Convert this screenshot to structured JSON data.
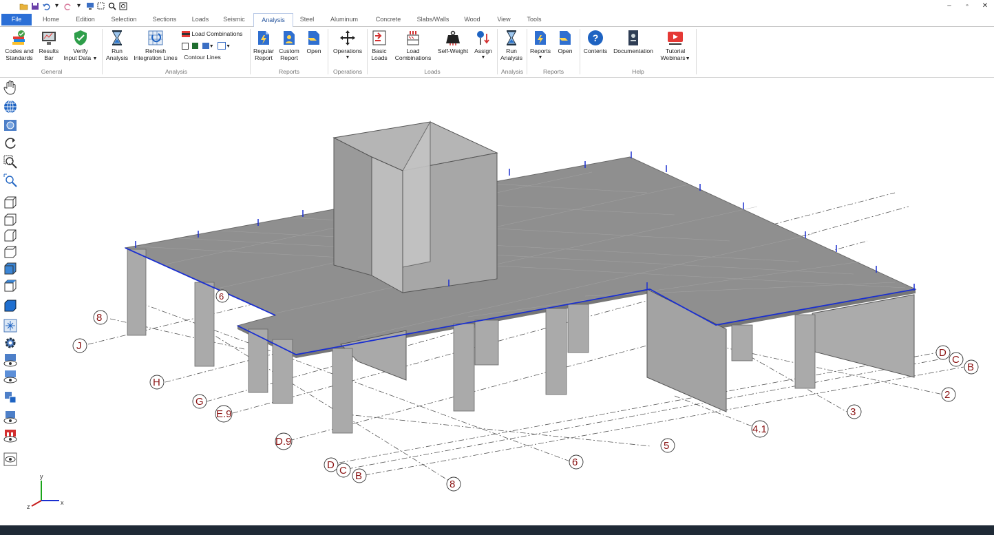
{
  "ribbon_tabs": [
    "File",
    "Home",
    "Edition",
    "Selection",
    "Sections",
    "Loads",
    "Seismic",
    "Analysis",
    "Steel",
    "Aluminum",
    "Concrete",
    "Slabs/Walls",
    "Wood",
    "View",
    "Tools"
  ],
  "active_tab": "Analysis",
  "buttons": {
    "codes": [
      "Codes and",
      "Standards"
    ],
    "results": [
      "Results",
      "Bar"
    ],
    "verify": [
      "Verify",
      "Input Data"
    ],
    "run": [
      "Run",
      "Analysis"
    ],
    "refresh": [
      "Refresh",
      "Integration Lines"
    ],
    "load_combinations_small": "Load Combinations",
    "contour_lines": "Contour Lines",
    "regular_report": [
      "Regular",
      "Report"
    ],
    "custom_report": [
      "Custom",
      "Report"
    ],
    "open": "Open",
    "operations": "Operations",
    "basic_loads": [
      "Basic",
      "Loads"
    ],
    "load_combinations": [
      "Load",
      "Combinations"
    ],
    "self_weight": "Self-Weight",
    "assign": "Assign",
    "run2": [
      "Run",
      "Analysis"
    ],
    "reports": "Reports",
    "open2": "Open",
    "contents": "Contents",
    "documentation": "Documentation",
    "tutorial": [
      "Tutorial",
      "Webinars"
    ]
  },
  "groups": [
    "General",
    "Analysis",
    "Reports",
    "Operations",
    "Loads",
    "Analysis",
    "Reports",
    "Help"
  ],
  "grid_labels": {
    "left_ends": [
      "8",
      "J",
      "H",
      "G",
      "E.9",
      "D.9",
      "D",
      "C",
      "B",
      "8"
    ],
    "right_ends": [
      "D",
      "C",
      "B",
      "2",
      "3",
      "4.1",
      "5",
      "6"
    ],
    "other": [
      "6"
    ]
  },
  "axes": {
    "x": "x",
    "y": "y",
    "z": "z"
  },
  "colors": {
    "accent": "#2b6fd6",
    "slab": "#8f8f8f",
    "column": "#a9a9a9",
    "beam": "#1a2fd0",
    "grid_text": "#8a1212",
    "statusbar": "#1f2a36"
  }
}
